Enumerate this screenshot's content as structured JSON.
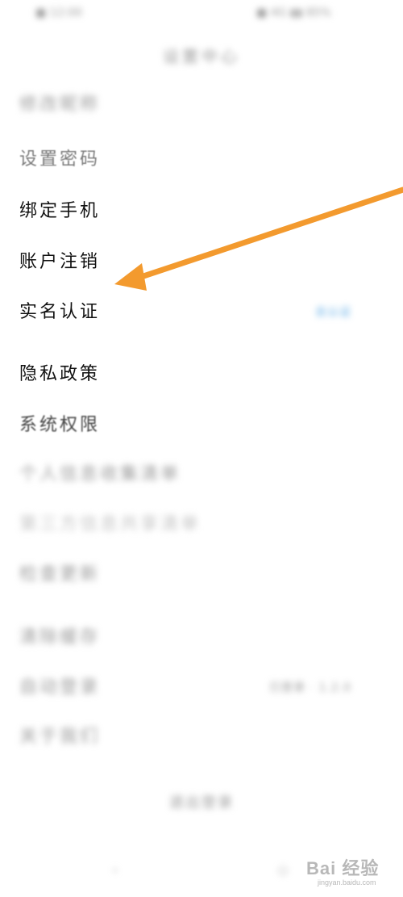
{
  "status_bar": {
    "left": "■ 12:00",
    "right": "■ 4G ▮▮ 85%"
  },
  "header": {
    "title": "设置中心"
  },
  "items": [
    {
      "label": "修改昵称",
      "value": ""
    },
    {
      "label": "设置密码",
      "value": ""
    },
    {
      "label": "绑定手机",
      "value": ""
    },
    {
      "label": "账户注销",
      "value": ""
    },
    {
      "label": "实名认证",
      "value": "去认证"
    },
    {
      "label": "隐私政策",
      "value": ""
    },
    {
      "label": "系统权限",
      "value": ""
    },
    {
      "label": "个人信息收集清单",
      "value": ""
    },
    {
      "label": "第三方信息共享清单",
      "value": ""
    },
    {
      "label": "检查更新",
      "value": ""
    },
    {
      "label": "清除缓存",
      "value": ""
    },
    {
      "label": "自动登录",
      "value": "已登录 · 1.2.0"
    },
    {
      "label": "关于我们",
      "value": ""
    }
  ],
  "footer": {
    "logout": "退出登录",
    "nav_left": "‹",
    "nav_right": "○"
  },
  "watermark": {
    "brand": "Bai 经验",
    "url": "jingyan.baidu.com"
  },
  "colors": {
    "arrow": "#f39a2e",
    "link": "#5aa9e6"
  }
}
